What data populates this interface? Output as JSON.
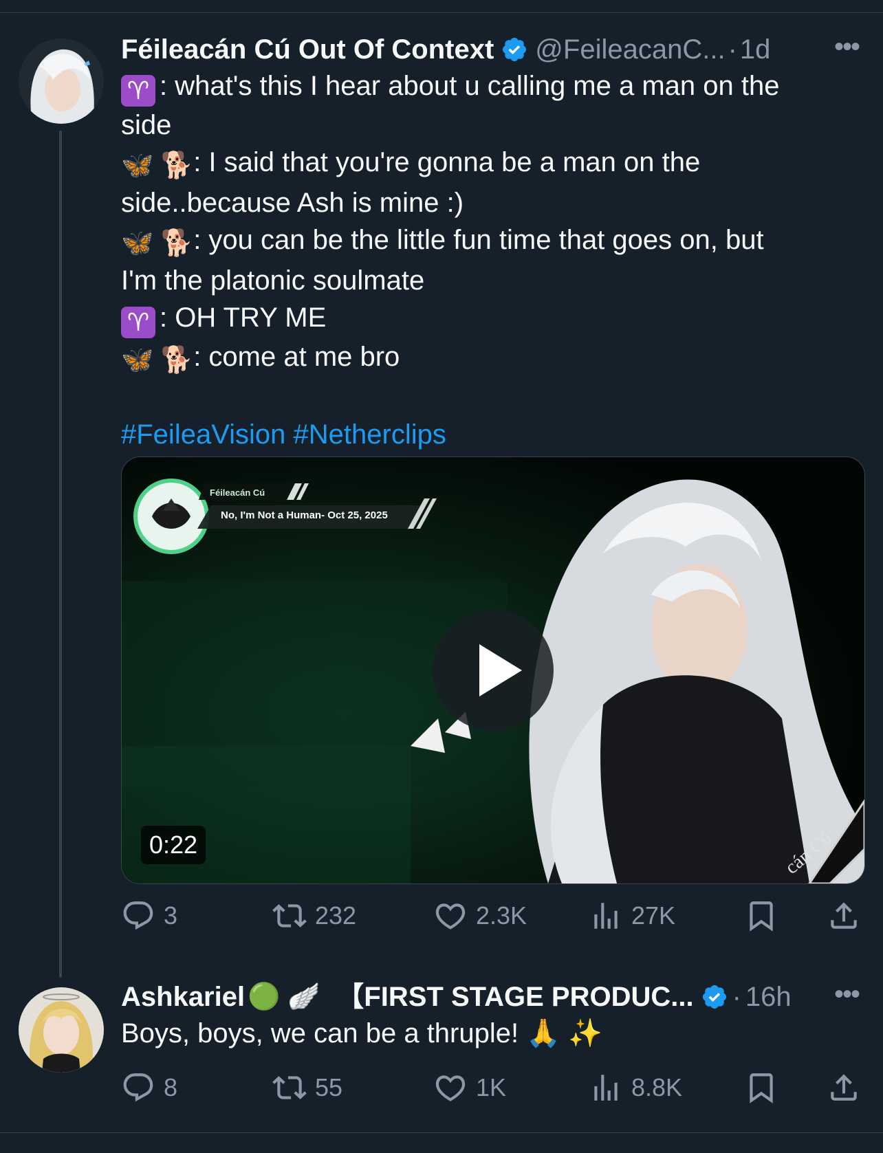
{
  "tweet1": {
    "display_name": "Féileacán Cú Out Of Context",
    "handle": "@FeileacanC...",
    "time_sep": "·",
    "time": "1d",
    "more": "•••",
    "lines": [
      {
        "parts": [
          "♈",
          ": what's this I hear about u calling me a man on the"
        ]
      },
      {
        "text": "side"
      },
      {
        "parts": [
          "🦋 🐕",
          ": I said that you're gonna be a man on the"
        ]
      },
      {
        "text": "side..because Ash is mine :)"
      },
      {
        "parts": [
          "🦋 🐕",
          ": you can be the little fun time that goes on, but"
        ]
      },
      {
        "text": "I'm the platonic soulmate"
      },
      {
        "parts": [
          "♈",
          ": OH TRY ME"
        ]
      },
      {
        "parts": [
          "🦋 🐕",
          ": come at me bro"
        ]
      }
    ],
    "hashtags": [
      "#FeileaVision",
      "#Netherclips"
    ],
    "video": {
      "duration": "0:22",
      "overlay_name": "Féileacán Cú",
      "overlay_title": "No, I'm Not a Human- Oct 25, 2025",
      "corner_text": "cán Cú"
    },
    "stats": {
      "replies": "3",
      "reposts": "232",
      "likes": "2.3K",
      "views": "27K"
    }
  },
  "tweet2": {
    "display_name": "Ashkariel",
    "name_emojis": "🟢 🪽",
    "name_suffix": "【FIRST STAGE PRODUC...",
    "time_sep": "·",
    "time": "16h",
    "more": "•••",
    "text": "Boys, boys, we can be a thruple! 🙏 ✨",
    "stats": {
      "replies": "8",
      "reposts": "55",
      "likes": "1K",
      "views": "8.8K"
    }
  },
  "colors": {
    "background": "#15202b",
    "accent": "#1d9bf0",
    "muted": "#8b98a5",
    "divider": "#38444d"
  },
  "icons": [
    "verified-badge-icon",
    "reply-icon",
    "repost-icon",
    "like-icon",
    "views-icon",
    "bookmark-icon",
    "share-icon",
    "play-icon"
  ]
}
